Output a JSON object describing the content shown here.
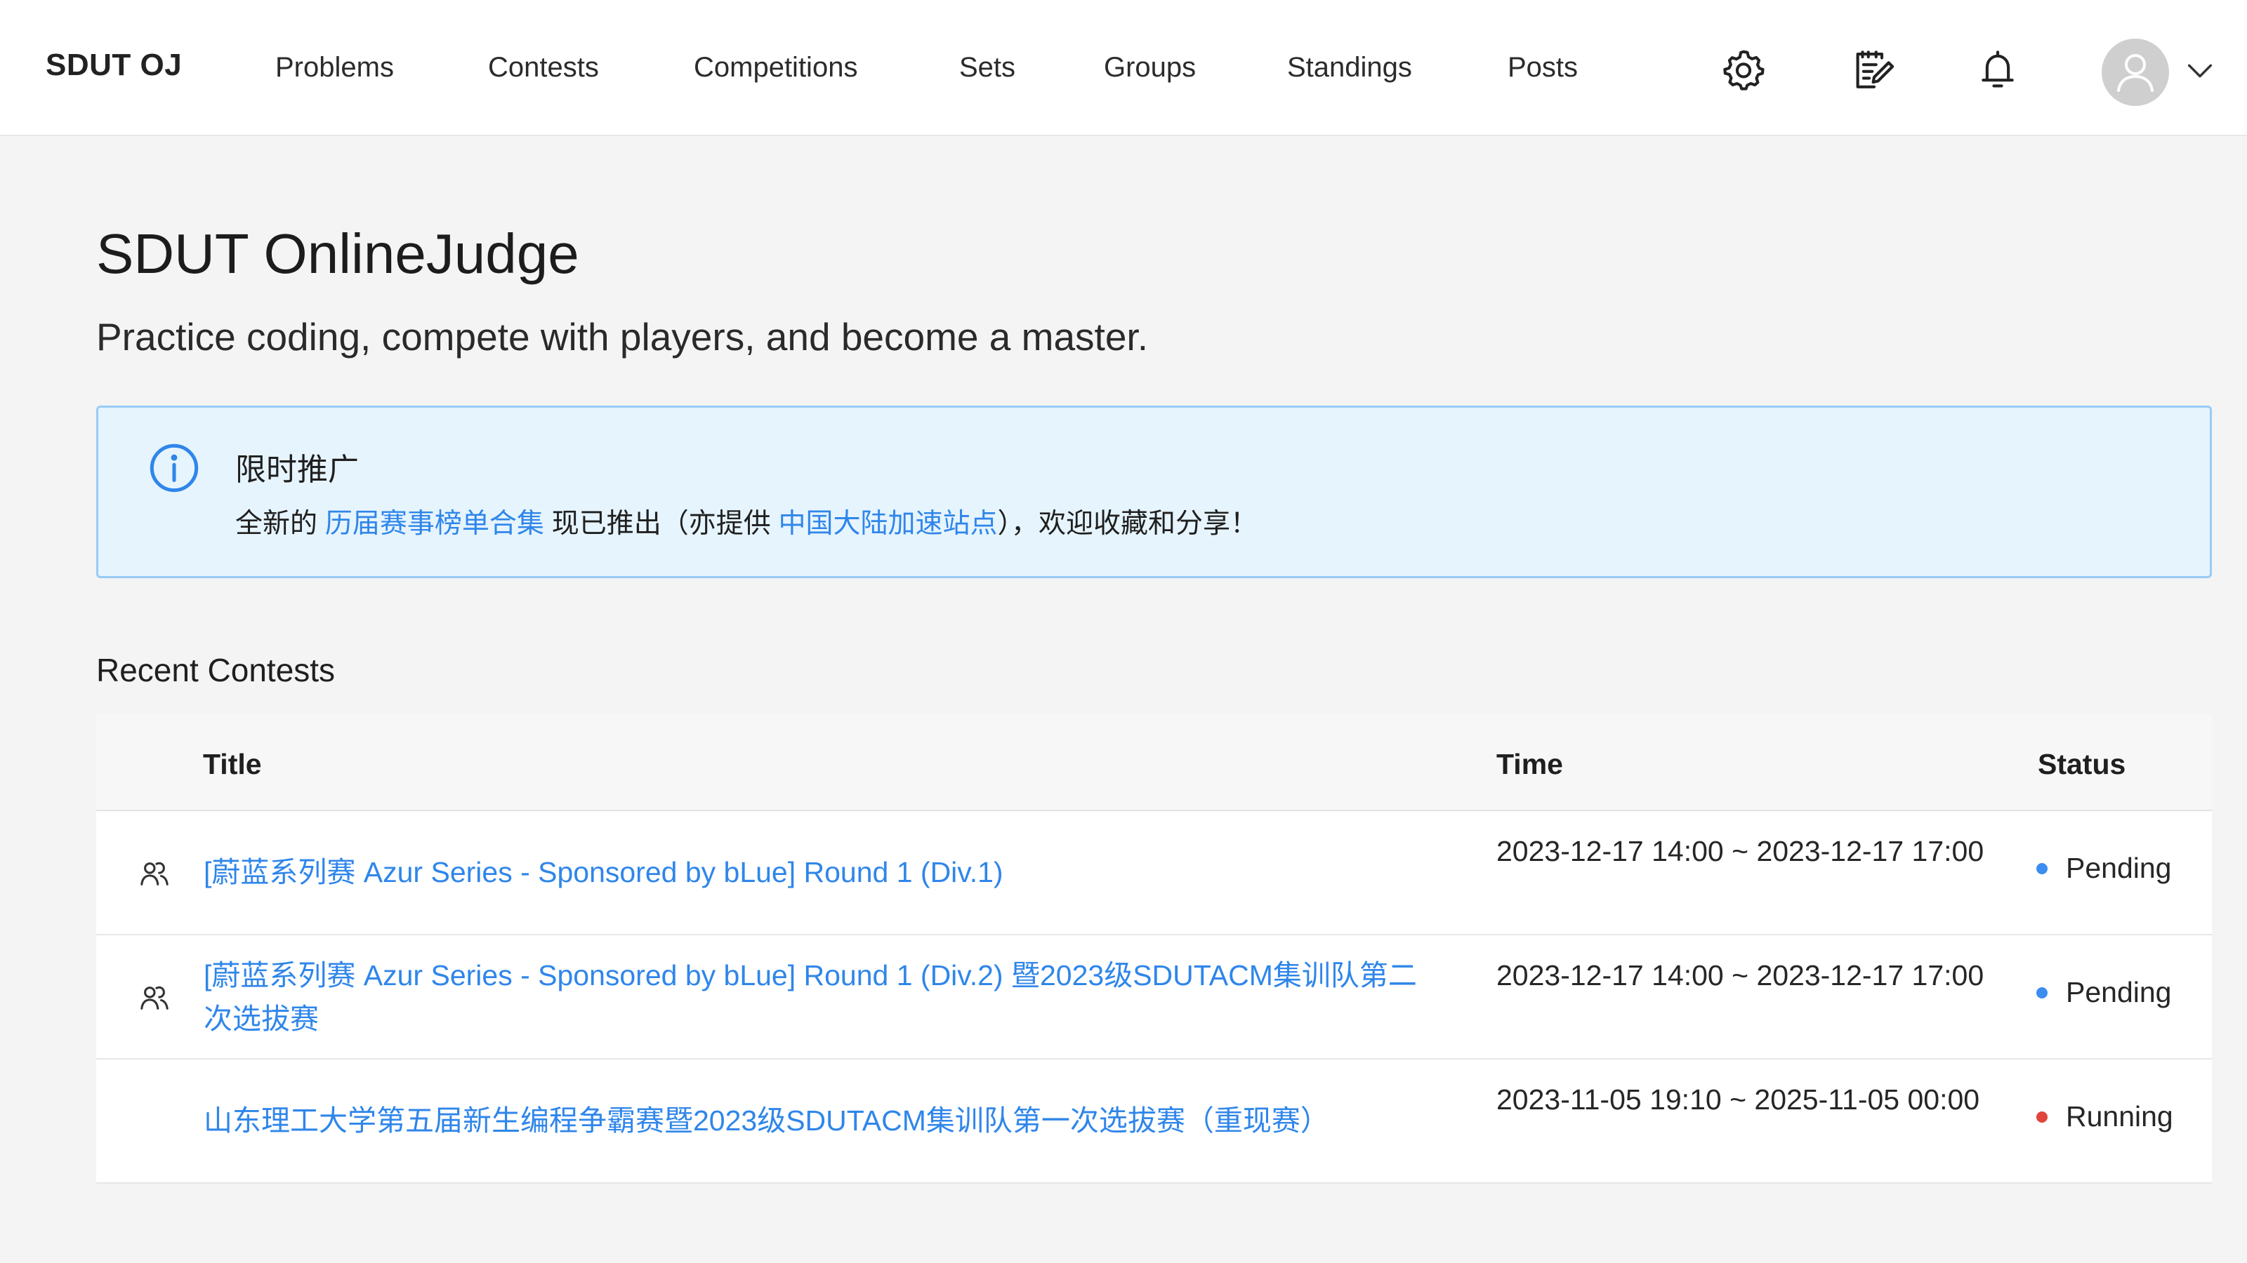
{
  "header": {
    "brand": "SDUT OJ",
    "nav": [
      {
        "label": "Problems"
      },
      {
        "label": "Contests"
      },
      {
        "label": "Competitions"
      },
      {
        "label": "Sets"
      },
      {
        "label": "Groups"
      },
      {
        "label": "Standings"
      },
      {
        "label": "Posts"
      }
    ],
    "icons": [
      "settings-icon",
      "edit-note-icon",
      "bell-icon",
      "avatar",
      "chevron-down-icon"
    ]
  },
  "hero": {
    "title": "SDUT OnlineJudge",
    "subtitle": "Practice coding, compete with players, and become a master."
  },
  "notice": {
    "title": "限时推广",
    "text_before": "全新的 ",
    "link1": "历届赛事榜单合集",
    "text_middle": " 现已推出（亦提供 ",
    "link2": "中国大陆加速站点",
    "text_after": "），欢迎收藏和分享！"
  },
  "recent": {
    "title": "Recent Contests",
    "columns": {
      "title": "Title",
      "time": "Time",
      "status": "Status"
    },
    "rows": [
      {
        "team_icon": true,
        "title": "[蔚蓝系列赛 Azur Series - Sponsored by bLue] Round 1 (Div.1)",
        "time": "2023-12-17 14:00 ~ 2023-12-17 17:00",
        "status": "Pending"
      },
      {
        "team_icon": true,
        "title": "[蔚蓝系列赛 Azur Series - Sponsored by bLue] Round 1 (Div.2) 暨2023级SDUTACM集训队第二次选拔赛",
        "time": "2023-12-17 14:00 ~ 2023-12-17 17:00",
        "status": "Pending"
      },
      {
        "team_icon": false,
        "title": "山东理工大学第五届新生编程争霸赛暨2023级SDUTACM集训队第一次选拔赛（重现赛）",
        "time": "2023-11-05 19:10 ~ 2025-11-05 00:00",
        "status": "Running"
      }
    ]
  },
  "colors": {
    "accent": "#2f86ea",
    "pending": "#3b8df0",
    "running": "#e0443b",
    "notice_bg": "#e6f4fd",
    "notice_border": "#98cbf6"
  }
}
